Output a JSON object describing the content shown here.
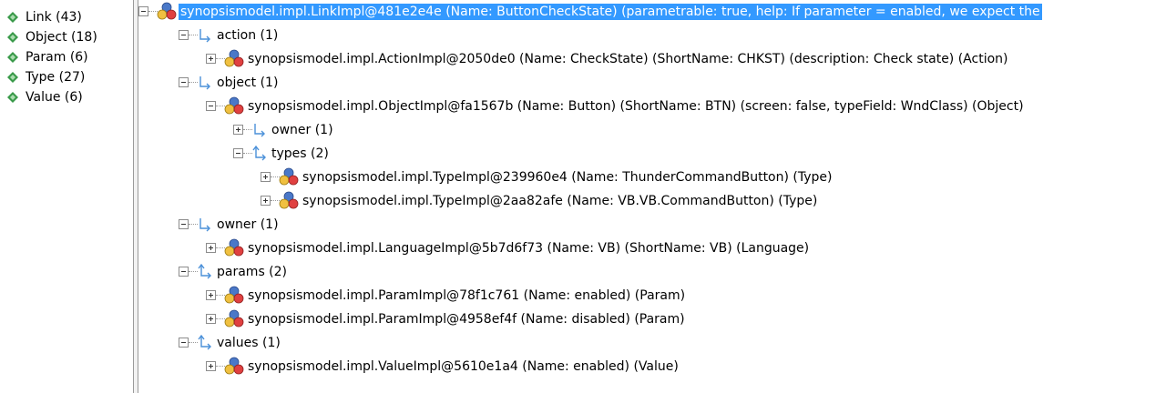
{
  "categories": [
    {
      "label": "Link (43)"
    },
    {
      "label": "Object (18)"
    },
    {
      "label": "Param (6)"
    },
    {
      "label": "Type (27)"
    },
    {
      "label": "Value (6)"
    }
  ],
  "tree": {
    "rows": [
      {
        "label": "synopsismodel.impl.LinkImpl@481e2e4e (Name: ButtonCheckState) (parametrable: true, help: If parameter = enabled,  we expect the",
        "icon": "model-object-icon",
        "expanded": true
      },
      {
        "label": "action (1)",
        "icon": "reference-arrow-icon",
        "expanded": true
      },
      {
        "label": "synopsismodel.impl.ActionImpl@2050de0 (Name: CheckState) (ShortName: CHKST) (description: Check state) (Action)",
        "icon": "model-object-icon",
        "expanded": false
      },
      {
        "label": "object (1)",
        "icon": "reference-arrow-icon",
        "expanded": true
      },
      {
        "label": "synopsismodel.impl.ObjectImpl@fa1567b (Name: Button) (ShortName: BTN) (screen: false, typeField: WndClass) (Object)",
        "icon": "model-object-icon",
        "expanded": true
      },
      {
        "label": "owner (1)",
        "icon": "reference-arrow-icon",
        "expanded": false
      },
      {
        "label": "types (2)",
        "icon": "multi-reference-icon",
        "expanded": true
      },
      {
        "label": "synopsismodel.impl.TypeImpl@239960e4 (Name: ThunderCommandButton) (Type)",
        "icon": "model-object-icon",
        "expanded": false
      },
      {
        "label": "synopsismodel.impl.TypeImpl@2aa82afe (Name: VB.VB.CommandButton) (Type)",
        "icon": "model-object-icon",
        "expanded": false
      },
      {
        "label": "owner (1)",
        "icon": "reference-arrow-icon",
        "expanded": true
      },
      {
        "label": "synopsismodel.impl.LanguageImpl@5b7d6f73 (Name: VB) (ShortName: VB) (Language)",
        "icon": "model-object-icon",
        "expanded": false
      },
      {
        "label": "params (2)",
        "icon": "multi-reference-icon",
        "expanded": true
      },
      {
        "label": "synopsismodel.impl.ParamImpl@78f1c761 (Name: enabled) (Param)",
        "icon": "model-object-icon",
        "expanded": false
      },
      {
        "label": "synopsismodel.impl.ParamImpl@4958ef4f (Name: disabled) (Param)",
        "icon": "model-object-icon",
        "expanded": false
      },
      {
        "label": "values (1)",
        "icon": "multi-reference-icon",
        "expanded": true
      },
      {
        "label": "synopsismodel.impl.ValueImpl@5610e1a4 (Name: enabled) (Value)",
        "icon": "model-object-icon",
        "expanded": false
      }
    ]
  },
  "colors": {
    "selection": "#3399ff",
    "category_icon": "#3a9a4a",
    "reference_arrow": "#4a90d9"
  }
}
